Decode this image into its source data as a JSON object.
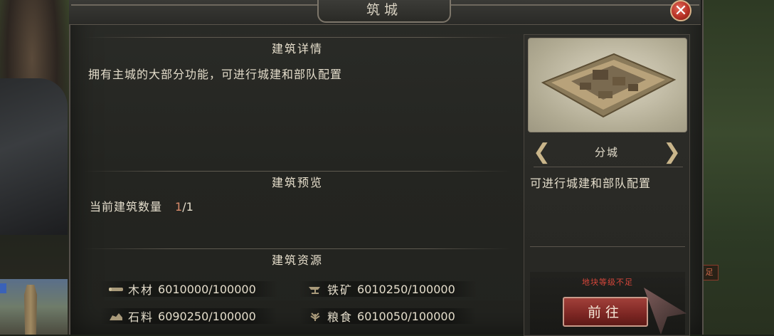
{
  "window": {
    "title": "筑城",
    "close_symbol": "✕"
  },
  "details": {
    "header": "建筑详情",
    "description": "拥有主城的大部分功能，可进行城建和部队配置"
  },
  "preview": {
    "header": "建筑预览",
    "count_label": "当前建筑数量",
    "count_current": "1",
    "count_total": "/1"
  },
  "resources": {
    "header": "建筑资源",
    "items": [
      {
        "icon": "wood-icon",
        "name": "木材",
        "value": "6010000/100000"
      },
      {
        "icon": "iron-ore-icon",
        "name": "铁矿",
        "value": "6010250/100000"
      },
      {
        "icon": "stone-icon",
        "name": "石料",
        "value": "6090250/100000"
      },
      {
        "icon": "grain-icon",
        "name": "粮食",
        "value": "6010050/100000"
      }
    ]
  },
  "building": {
    "name": "分城",
    "description": "可进行城建和部队配置",
    "prev_symbol": "❮",
    "next_symbol": "❯"
  },
  "action": {
    "warning": "地块等级不足",
    "button_label": "前往"
  },
  "side_tag": "足",
  "colors": {
    "accent_red": "#d5463a",
    "button_red": "#7c2623",
    "count_highlight": "#d88a6a",
    "text": "#e4ddcb"
  }
}
